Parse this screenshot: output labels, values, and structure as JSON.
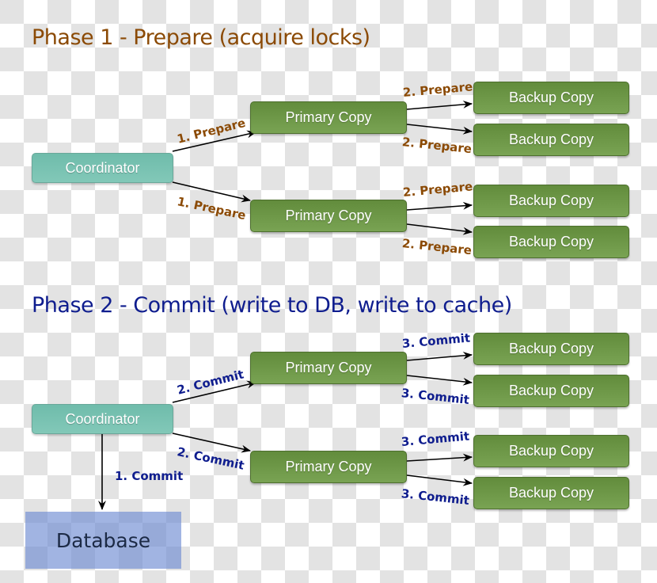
{
  "phase1": {
    "title": "Phase 1 - Prepare (acquire locks)",
    "coordinator": "Coordinator",
    "primaries": [
      {
        "label": "Primary Copy",
        "edge_label": "1. Prepare",
        "backups": [
          {
            "label": "Backup Copy",
            "edge_label": "2. Prepare"
          },
          {
            "label": "Backup Copy",
            "edge_label": "2. Prepare"
          }
        ]
      },
      {
        "label": "Primary Copy",
        "edge_label": "1. Prepare",
        "backups": [
          {
            "label": "Backup Copy",
            "edge_label": "2. Prepare"
          },
          {
            "label": "Backup Copy",
            "edge_label": "2. Prepare"
          }
        ]
      }
    ]
  },
  "phase2": {
    "title": "Phase 2 - Commit (write to DB, write to cache)",
    "coordinator": "Coordinator",
    "database": "Database",
    "database_edge_label": "1. Commit",
    "primaries": [
      {
        "label": "Primary Copy",
        "edge_label": "2. Commit",
        "backups": [
          {
            "label": "Backup Copy",
            "edge_label": "3. Commit"
          },
          {
            "label": "Backup Copy",
            "edge_label": "3. Commit"
          }
        ]
      },
      {
        "label": "Primary Copy",
        "edge_label": "2. Commit",
        "backups": [
          {
            "label": "Backup Copy",
            "edge_label": "3. Commit"
          },
          {
            "label": "Backup Copy",
            "edge_label": "3. Commit"
          }
        ]
      }
    ]
  },
  "colors": {
    "phase1_text": "#8b4a05",
    "phase2_text": "#0f1d8e",
    "coordinator": "#78c2b1",
    "copy_node": "#6d9747",
    "database": "#8ca5dc"
  }
}
